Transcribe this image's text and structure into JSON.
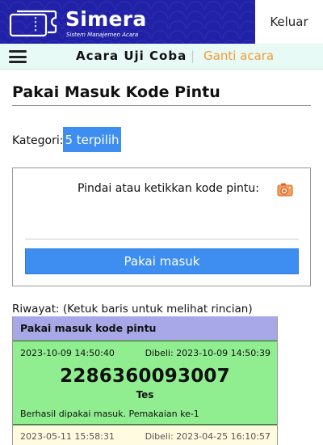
{
  "header": {
    "brand_name": "Simera",
    "brand_tagline": "Sistem Manajemen Acara",
    "logout_label": "Keluar",
    "brand_color": "#2121a8"
  },
  "subbar": {
    "event_name": "Acara Uji Coba",
    "separator": "|",
    "change_event_label": "Ganti acara",
    "accent_color": "#f39a37"
  },
  "main": {
    "page_title": "Pakai Masuk Kode Pintu",
    "category_label": "Kategori:",
    "category_button": "5 terpilih",
    "scan_prompt": "Pindai atau ketikkan kode pintu:",
    "code_input_value": "",
    "code_input_placeholder": "",
    "submit_label": "Pakai masuk",
    "primary_color": "#3d8ef0"
  },
  "history": {
    "label": "Riwayat: (Ketuk baris untuk melihat rincian)",
    "header": "Pakai masuk kode pintu",
    "entries": [
      {
        "used_at": "2023-10-09 14:50:40",
        "bought_at": "Dibeli: 2023-10-09 14:50:39",
        "code": "2286360093007",
        "name": "Tes",
        "status": "Berhasil dipakai masuk. Pemakaian ke-1",
        "color": "#90ee90"
      },
      {
        "used_at": "2023-05-11 15:58:31",
        "bought_at": "Dibeli: 2023-04-25 16:10:57",
        "color": "#fffbe0"
      }
    ]
  },
  "icons": {
    "logo": "ticket-icon",
    "menu": "hamburger-icon",
    "camera": "camera-icon"
  }
}
